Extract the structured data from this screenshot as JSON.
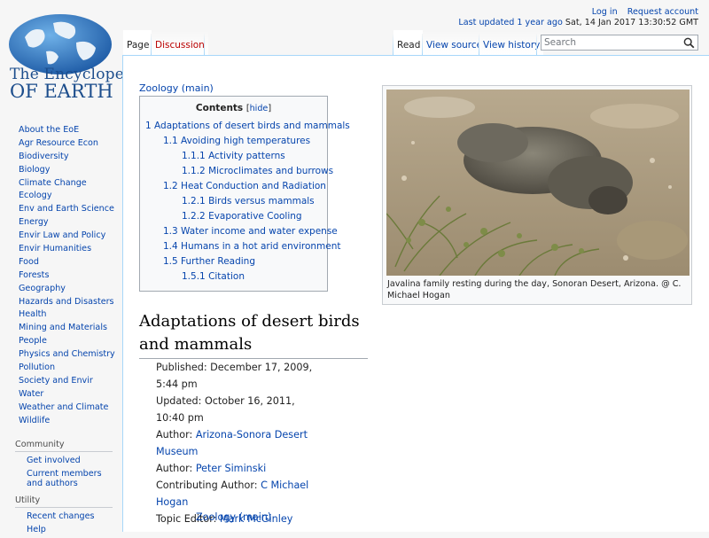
{
  "logo": {
    "line1": "The Encyclopedia",
    "line2": "OF EARTH"
  },
  "sidebar": {
    "nav": [
      "About the EoE",
      "Agr Resource Econ",
      "Biodiversity",
      "Biology",
      "Climate Change",
      "Ecology",
      "Env and Earth Science",
      "Energy",
      "Envir Law and Policy",
      "Envir Humanities",
      "Food",
      "Forests",
      "Geography",
      "Hazards and Disasters",
      "Health",
      "Mining and Materials",
      "People",
      "Physics and Chemistry",
      "Pollution",
      "Society and Envir",
      "Water",
      "Weather and Climate",
      "Wildlife"
    ],
    "community_heading": "Community",
    "community": [
      "Get involved",
      "Current members and authors"
    ],
    "utility_heading": "Utility",
    "utility": [
      "Recent changes",
      "Help"
    ]
  },
  "personal": {
    "login": "Log in",
    "request": "Request account"
  },
  "last_updated": {
    "label": "Last updated 1 year ago",
    "date": "Sat, 14 Jan 2017 13:30:52 GMT"
  },
  "tabs": {
    "page": "Page",
    "discussion": "Discussion",
    "read": "Read",
    "view_source": "View source",
    "view_history": "View history"
  },
  "search": {
    "placeholder": "Search"
  },
  "category_link": "Zoology (main)",
  "toc": {
    "title": "Contents",
    "hide": "hide",
    "items": [
      {
        "num": "1",
        "text": "Adaptations of desert birds and mammals",
        "level": 1
      },
      {
        "num": "1.1",
        "text": "Avoiding high temperatures",
        "level": 2
      },
      {
        "num": "1.1.1",
        "text": "Activity patterns",
        "level": 3
      },
      {
        "num": "1.1.2",
        "text": "Microclimates and burrows",
        "level": 3
      },
      {
        "num": "1.2",
        "text": "Heat Conduction and Radiation",
        "level": 2
      },
      {
        "num": "1.2.1",
        "text": "Birds versus mammals",
        "level": 3
      },
      {
        "num": "1.2.2",
        "text": "Evaporative Cooling",
        "level": 3
      },
      {
        "num": "1.3",
        "text": "Water income and water expense",
        "level": 2
      },
      {
        "num": "1.4",
        "text": "Humans in a hot arid environment",
        "level": 2
      },
      {
        "num": "1.5",
        "text": "Further Reading",
        "level": 2
      },
      {
        "num": "1.5.1",
        "text": "Citation",
        "level": 3
      }
    ]
  },
  "heading": "Adaptations of desert birds and mammals",
  "meta": {
    "published": "Published: December 17, 2009, 5:44 pm",
    "updated": "Updated: October 16, 2011, 10:40 pm",
    "author_label": "Author:",
    "author": "Arizona-Sonora Desert Museum",
    "author2_label": "Author:",
    "author2": "Peter Siminski",
    "contributing_label": "Contributing Author:",
    "contributing": "C Michael Hogan",
    "editor_label": "Topic Editor:",
    "editor": "Mark McGinley",
    "zoology": "Zoology (main)"
  },
  "thumb": {
    "caption": "Javalina family resting during the day, Sonoran Desert, Arizona. @ C. Michael Hogan"
  }
}
